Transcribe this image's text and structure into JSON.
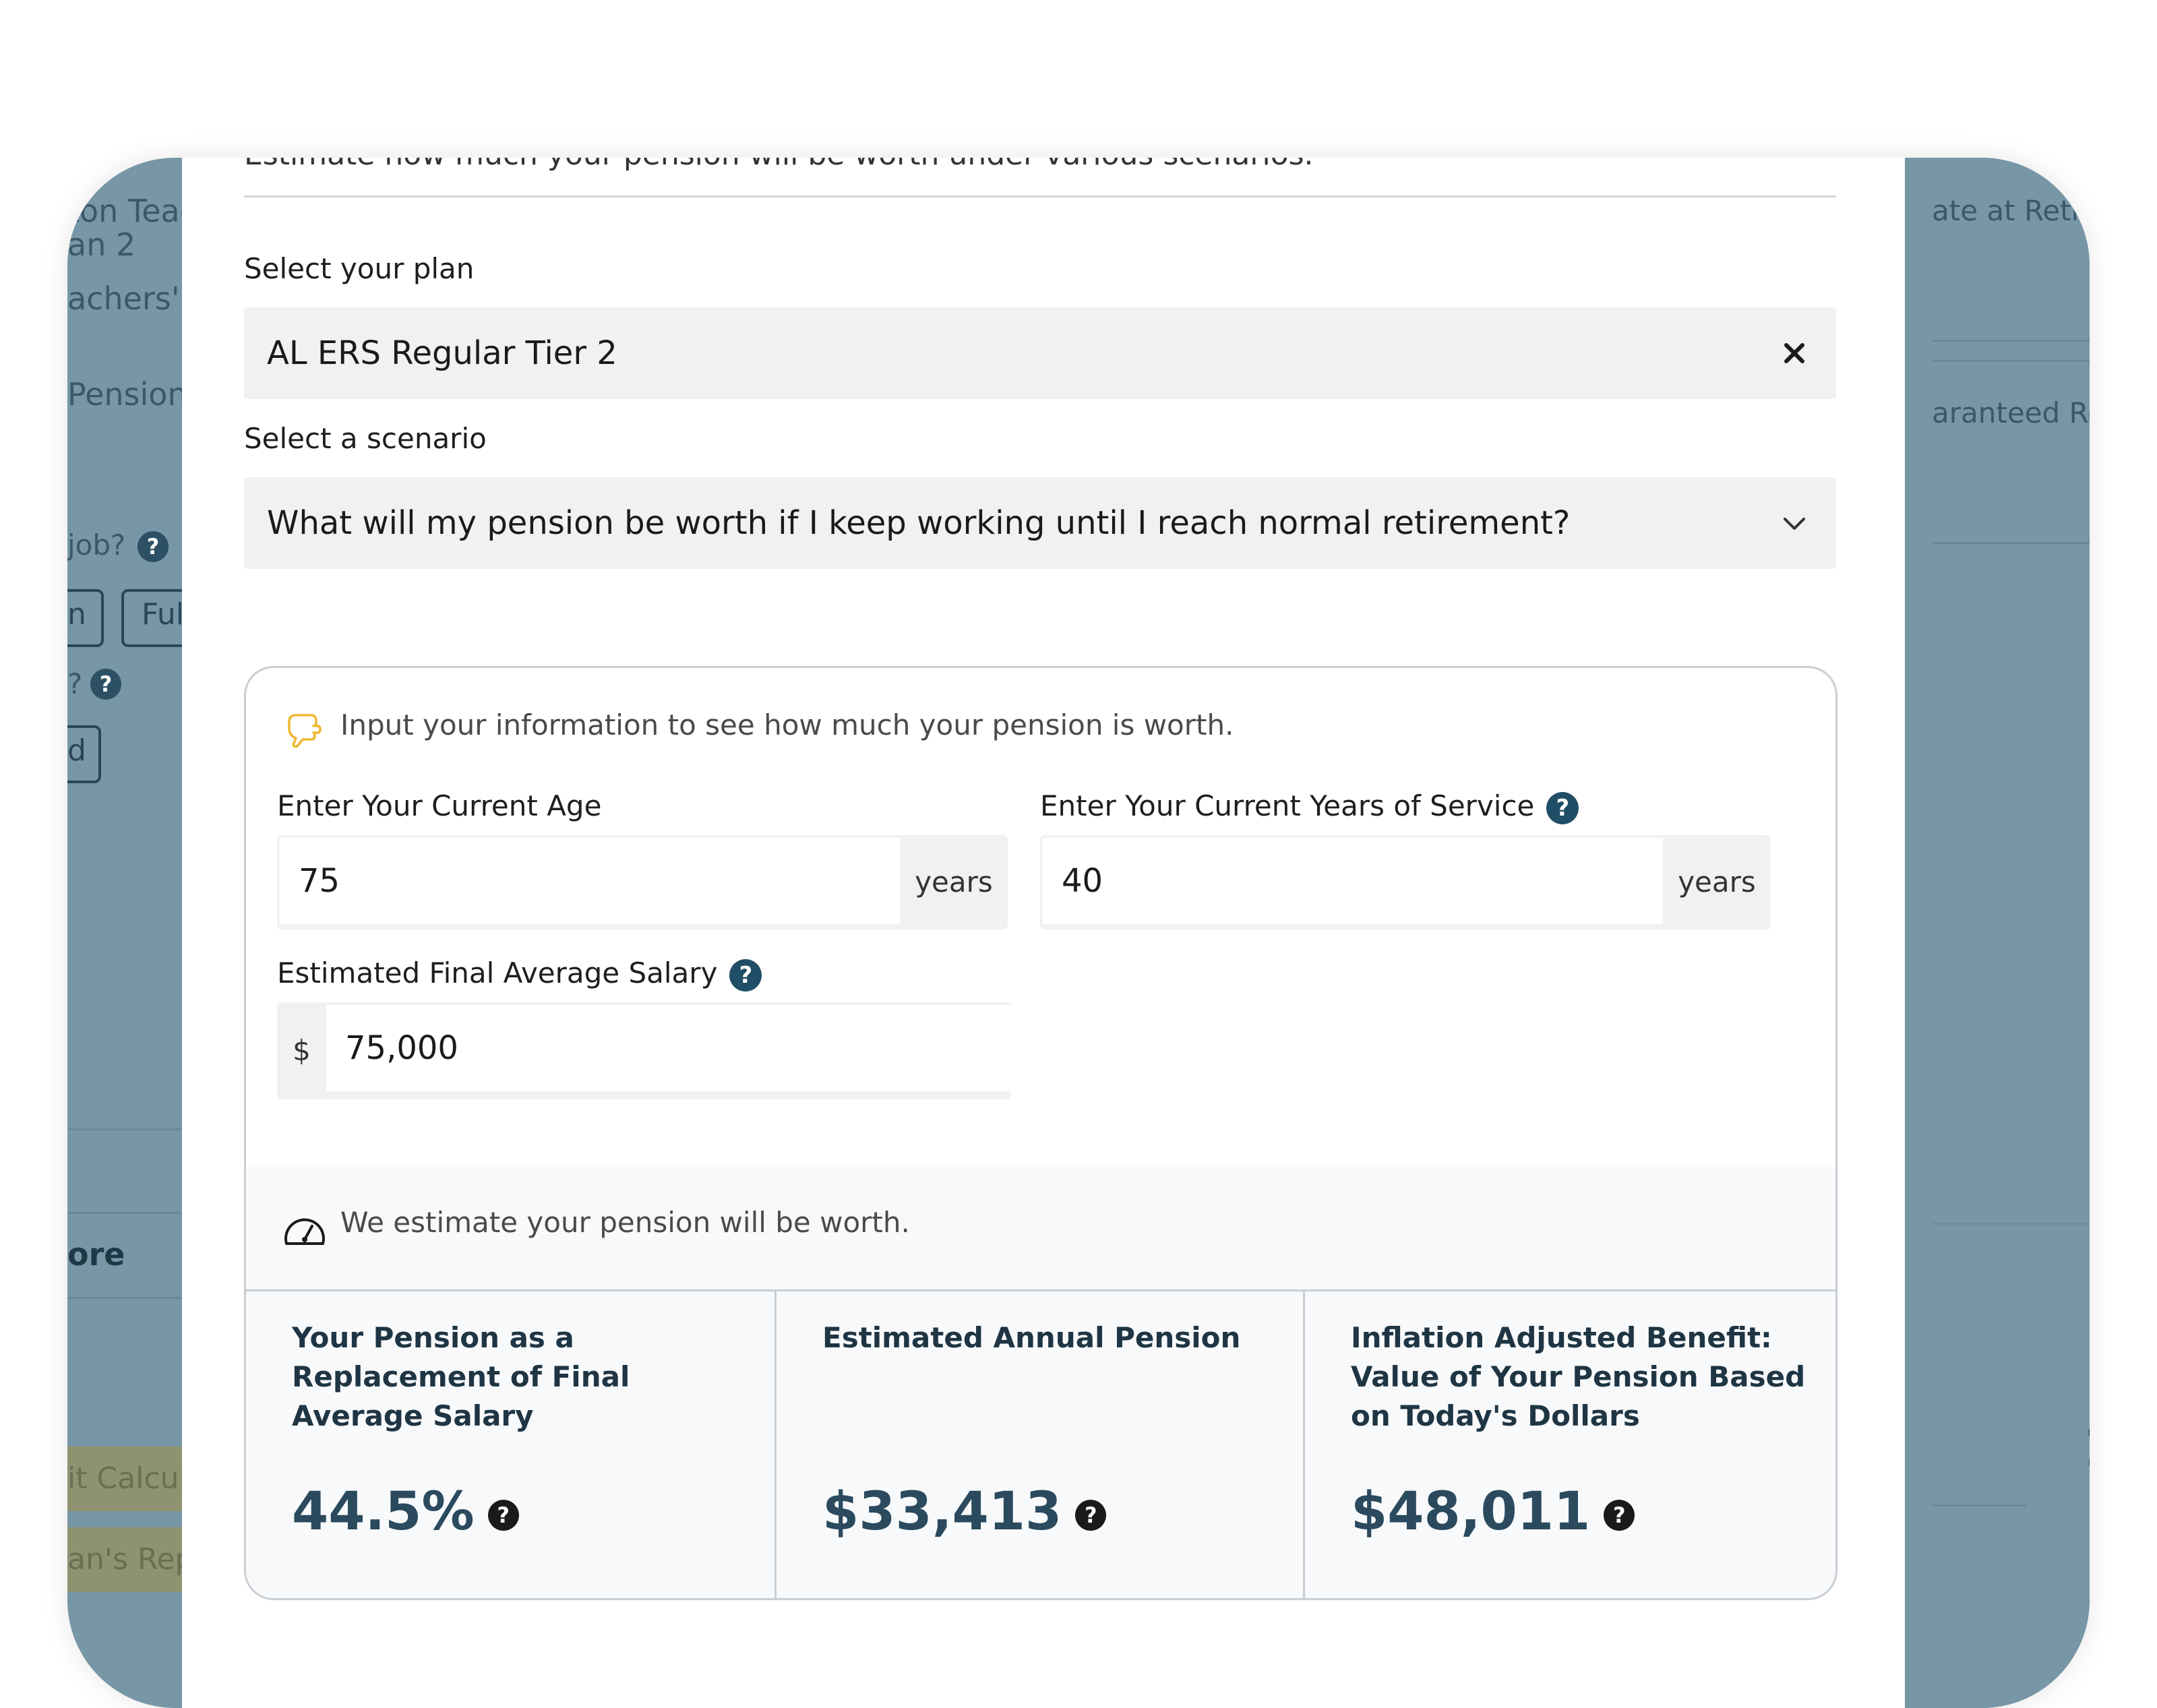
{
  "modal": {
    "cutoff_text": "Estimate how much your pension will be worth under various scenarios.",
    "plan_label": "Select your plan",
    "plan_value": "AL ERS Regular Tier 2",
    "scenario_label": "Select a scenario",
    "scenario_value": "What will my pension be worth if I keep working until I reach normal retirement?"
  },
  "form": {
    "hint": "Input your information to see how much your pension is worth.",
    "age_label": "Enter Your Current Age",
    "age_value": "75",
    "age_unit": "years",
    "service_label": "Enter Your Current Years of Service",
    "service_value": "40",
    "service_unit": "years",
    "salary_label": "Estimated Final Average Salary",
    "salary_prefix": "$",
    "salary_value": "75,000"
  },
  "results": {
    "hint": "We estimate your pension will be worth.",
    "items": [
      {
        "title": "Your Pension as a Replacement of Final Average Salary",
        "value": "44.5%"
      },
      {
        "title": "Estimated Annual Pension",
        "value": "$33,413"
      },
      {
        "title": "Inflation Adjusted Benefit: Value of Your Pension Based on Today's Dollars",
        "value": "$48,011"
      }
    ]
  },
  "background": {
    "left": {
      "line1": "ton Teac",
      "line2": "an 2",
      "line3": "achers'",
      "line4": "Pension",
      "job_q": "job?",
      "btn1": "n",
      "btn2": "Ful",
      "q2": "?",
      "btn3": "d",
      "more": "ore",
      "tan1": "it Calcula",
      "tan2": "an's Rep"
    },
    "right": {
      "line1": "ate at Retir",
      "line2": "aranteed Re",
      "digit": "1"
    }
  },
  "colors": {
    "overlay": "#7796a6",
    "focus_border": "#4a72d6",
    "help_icon": "#1f4e66",
    "value_text": "#2b4a5e"
  }
}
